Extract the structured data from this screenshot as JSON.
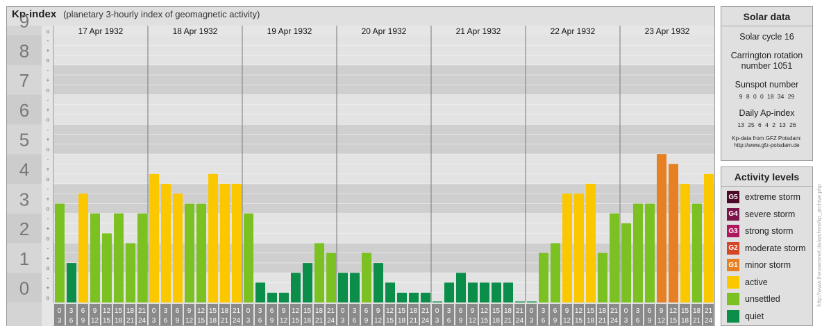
{
  "title": {
    "main": "Kp-index",
    "subtitle": "(planetary 3-hourly index of geomagnetic activity)"
  },
  "chart_data": {
    "type": "bar",
    "days": [
      "17 Apr 1932",
      "18 Apr 1932",
      "19 Apr 1932",
      "20 Apr 1932",
      "21 Apr 1932",
      "22 Apr 1932",
      "23 Apr 1932"
    ],
    "y_labels": [
      "0",
      "1",
      "2",
      "3",
      "4",
      "5",
      "6",
      "7",
      "8",
      "9"
    ],
    "sub_labels": [
      "o",
      "+",
      "-"
    ],
    "x_ticks_top": [
      "0",
      "3",
      "6",
      "9",
      "12",
      "15",
      "18",
      "21"
    ],
    "x_ticks_bottom": [
      "3",
      "6",
      "9",
      "12",
      "15",
      "18",
      "21",
      "24"
    ],
    "ylim": [
      0,
      9
    ],
    "values": [
      3.33,
      1.33,
      3.67,
      3.0,
      2.33,
      3.0,
      2.0,
      3.0,
      4.33,
      4.0,
      3.67,
      3.33,
      3.33,
      4.33,
      4.0,
      4.0,
      3.0,
      0.67,
      0.33,
      0.33,
      1.0,
      1.33,
      2.0,
      1.67,
      1.0,
      1.0,
      1.67,
      1.33,
      0.67,
      0.33,
      0.33,
      0.33,
      0.0,
      0.67,
      1.0,
      0.67,
      0.67,
      0.67,
      0.67,
      0.0,
      0.0,
      1.67,
      2.0,
      3.67,
      3.67,
      4.0,
      1.67,
      3.0,
      2.67,
      3.33,
      3.33,
      5.0,
      4.67,
      4.0,
      3.33,
      4.33
    ],
    "colors": {
      "quiet": "#0b8e4a",
      "unsettled": "#7cc122",
      "active": "#fbc800",
      "minor": "#e68022",
      "moderate": "#d64526",
      "strong": "#b0175e",
      "severe": "#7b1549",
      "extreme": "#4d0a28"
    }
  },
  "solar": {
    "title": "Solar data",
    "cycle": "Solar cycle 16",
    "carrington_1": "Carrington rotation",
    "carrington_2": "number 1051",
    "sunspot_title": "Sunspot number",
    "sunspot_values": "9   8   0   0   18   34   29",
    "ap_title": "Daily Ap-index",
    "ap_values": "13   25   6   4   2   13   26",
    "credit_1": "Kp-data from GFZ Potsdam:",
    "credit_2": "http://www.gfz-potsdam.de"
  },
  "activity": {
    "title": "Activity levels",
    "levels": [
      {
        "badge": "G5",
        "label": "extreme storm",
        "color": "#4d0a28"
      },
      {
        "badge": "G4",
        "label": "severe storm",
        "color": "#7b1549"
      },
      {
        "badge": "G3",
        "label": "strong storm",
        "color": "#b0175e"
      },
      {
        "badge": "G2",
        "label": "moderate storm",
        "color": "#d64526"
      },
      {
        "badge": "G1",
        "label": "minor storm",
        "color": "#e68022"
      },
      {
        "badge": "",
        "label": "active",
        "color": "#fbc800"
      },
      {
        "badge": "",
        "label": "unsettled",
        "color": "#7cc122"
      },
      {
        "badge": "",
        "label": "quiet",
        "color": "#0b8e4a"
      }
    ]
  },
  "watermark": "http://www.theusersnet.de/archive/kp_archive.php"
}
